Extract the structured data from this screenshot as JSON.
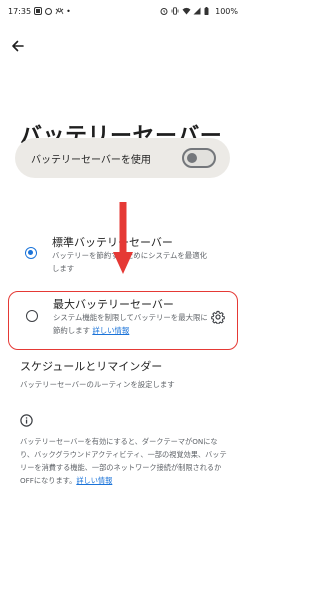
{
  "status_bar": {
    "time": "17:35",
    "battery": "100%"
  },
  "page": {
    "title": "バッテリーセーバー"
  },
  "main_toggle": {
    "label": "バッテリーセーバーを使用",
    "state": "off"
  },
  "options": [
    {
      "title": "標準バッテリーセーバー",
      "description": "バッテリーを節約するためにシステムを最適化します",
      "selected": true
    },
    {
      "title": "最大バッテリーセーバー",
      "description": "システム機能を制限してバッテリーを最大限に節約します",
      "link": "詳しい情報",
      "selected": false
    }
  ],
  "schedule": {
    "title": "スケジュールとリマインダー",
    "description": "バッテリーセーバーのルーティンを設定します"
  },
  "footer": {
    "text": "バッテリーセーバーを有効にすると、ダークテーマがONになり、バックグラウンドアクティビティ、一部の視覚効果、バッテリーを消費する機能、一部のネットワーク接続が制限されるかOFFになります。",
    "link": "詳しい情報"
  },
  "colors": {
    "accent": "#1a73d9",
    "highlight": "#e53935",
    "toggle_bg": "#eceae6"
  }
}
